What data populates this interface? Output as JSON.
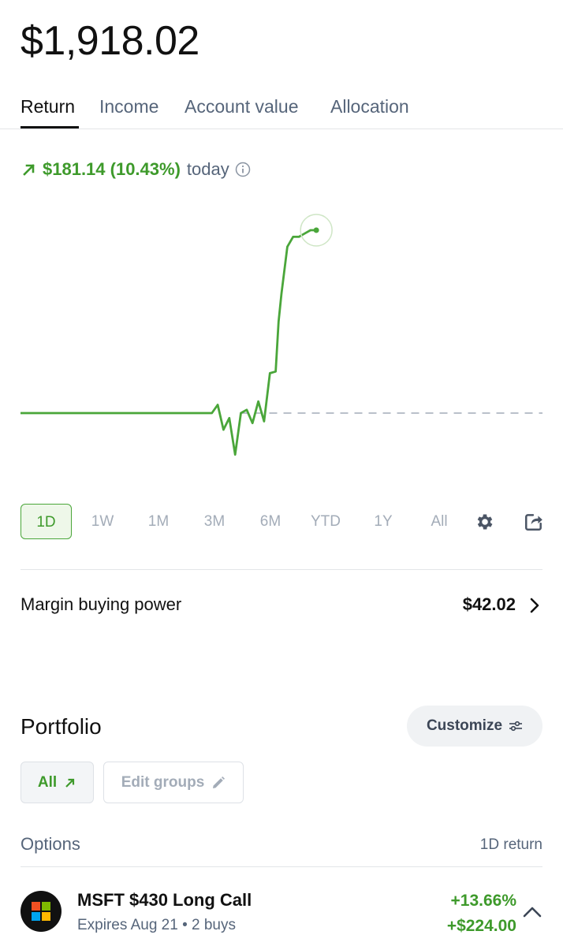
{
  "account": {
    "balance": "$1,918.02"
  },
  "tabs": [
    {
      "label": "Return",
      "active": true
    },
    {
      "label": "Income",
      "active": false
    },
    {
      "label": "Account value",
      "active": false
    },
    {
      "label": "Allocation",
      "active": false
    }
  ],
  "return_summary": {
    "value": "$181.14 (10.43%)",
    "period": "today",
    "direction_icon": "arrow-up-right-icon",
    "info_icon": "info-icon"
  },
  "chart_data": {
    "type": "line",
    "x": [
      0,
      5,
      10,
      15,
      20,
      25,
      30,
      32,
      33,
      34,
      35,
      36,
      37,
      38,
      39,
      40,
      41,
      42,
      43,
      44,
      44.5,
      45,
      46,
      47,
      48,
      49,
      50,
      51
    ],
    "y": [
      0,
      0,
      0,
      0,
      0,
      0,
      0,
      0,
      0,
      5,
      -10,
      -3,
      -25,
      0,
      2,
      -6,
      7,
      -5,
      24,
      25,
      55,
      72,
      100,
      106,
      106,
      108,
      110,
      110
    ],
    "baseline": 0,
    "baseline_style": "dashed",
    "series": [
      {
        "values": [],
        "color": "#4aa63a"
      }
    ],
    "current_point_marker": true,
    "grid": false,
    "title": "",
    "xlabel": "",
    "ylabel": ""
  },
  "time_ranges": [
    {
      "label": "1D",
      "active": true
    },
    {
      "label": "1W",
      "active": false
    },
    {
      "label": "1M",
      "active": false
    },
    {
      "label": "3M",
      "active": false
    },
    {
      "label": "6M",
      "active": false
    },
    {
      "label": "YTD",
      "active": false
    },
    {
      "label": "1Y",
      "active": false
    },
    {
      "label": "All",
      "active": false
    }
  ],
  "chart_actions": {
    "settings_icon": "gear-icon",
    "share_icon": "share-icon"
  },
  "margin": {
    "label": "Margin buying power",
    "value": "$42.02"
  },
  "portfolio": {
    "title": "Portfolio",
    "customize_label": "Customize",
    "filters": {
      "all_label": "All",
      "edit_groups_label": "Edit groups"
    }
  },
  "options_section": {
    "title": "Options",
    "column_label": "1D return",
    "positions": [
      {
        "name": "MSFT $430 Long Call",
        "detail": "Expires Aug 21 • 2 buys",
        "return_pct": "+13.66%",
        "return_amount": "+$224.00",
        "logo_icon": "microsoft-logo-icon"
      }
    ]
  },
  "colors": {
    "gain": "#3e9a2b",
    "chart_line": "#4aa63a",
    "muted": "#56657a"
  }
}
